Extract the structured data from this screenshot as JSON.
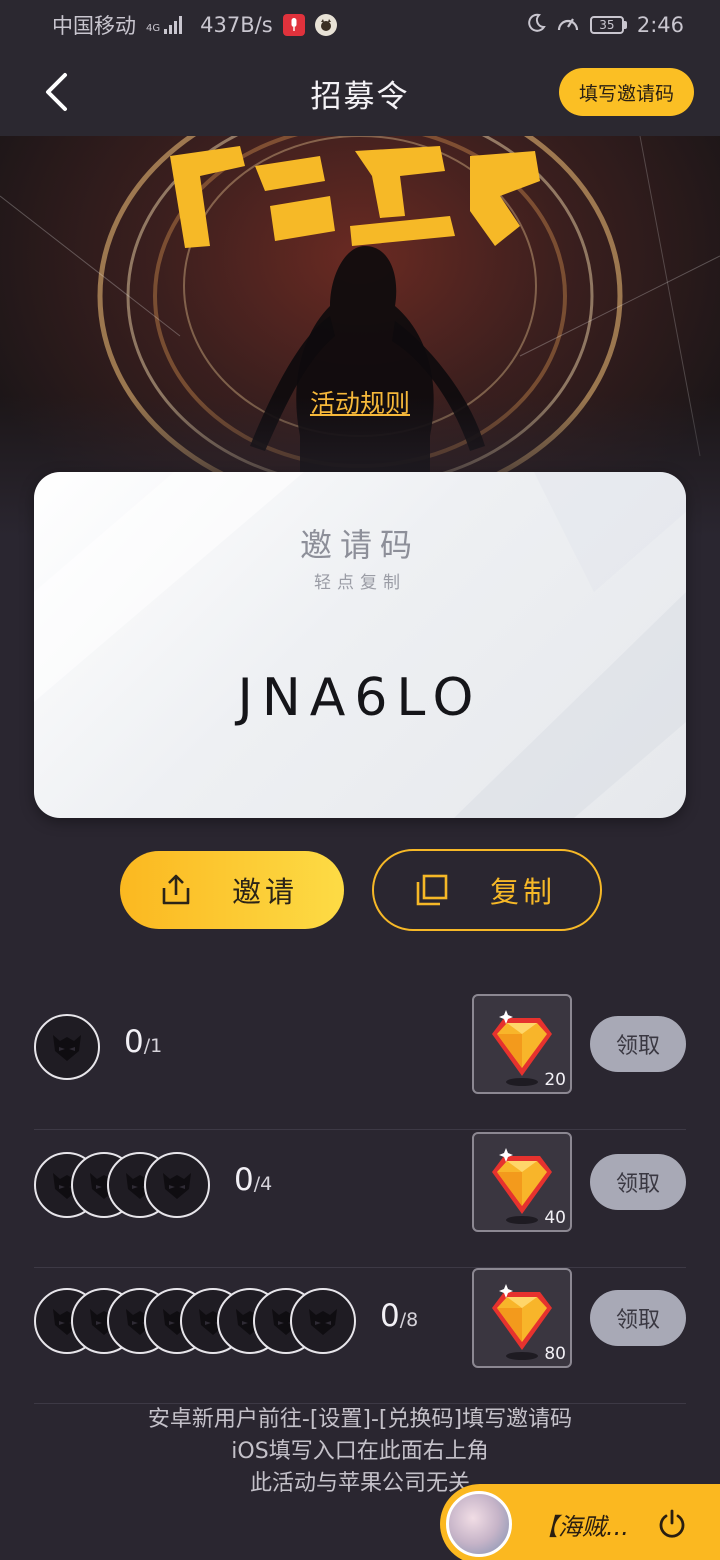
{
  "status_bar": {
    "carrier": "中国移动",
    "network_type": "4G",
    "speed": "437B/s",
    "battery": "35",
    "time": "2:46"
  },
  "header": {
    "title": "招募令",
    "invite_code_button": "填写邀请码"
  },
  "banner": {
    "rules_link": "活动规则"
  },
  "code_card": {
    "title": "邀请码",
    "subtitle": "轻点复制",
    "code": "JNA6LO"
  },
  "actions": {
    "invite_label": "邀请",
    "copy_label": "复制"
  },
  "rewards": [
    {
      "current": "0",
      "total": "/1",
      "gem_amount": "20",
      "claim_label": "领取",
      "avatar_count": 1
    },
    {
      "current": "0",
      "total": "/4",
      "gem_amount": "40",
      "claim_label": "领取",
      "avatar_count": 4
    },
    {
      "current": "0",
      "total": "/8",
      "gem_amount": "80",
      "claim_label": "领取",
      "avatar_count": 8
    }
  ],
  "notes": {
    "line1": "安卓新用户前往-[设置]-[兑换码]填写邀请码",
    "line2": "iOS填写入口在此面右上角",
    "line3": "此活动与苹果公司无关"
  },
  "mini_player": {
    "title": "【海贼..."
  },
  "colors": {
    "accent": "#fbb820",
    "background": "#2a2630",
    "claim_disabled": "#a8a9b6"
  }
}
